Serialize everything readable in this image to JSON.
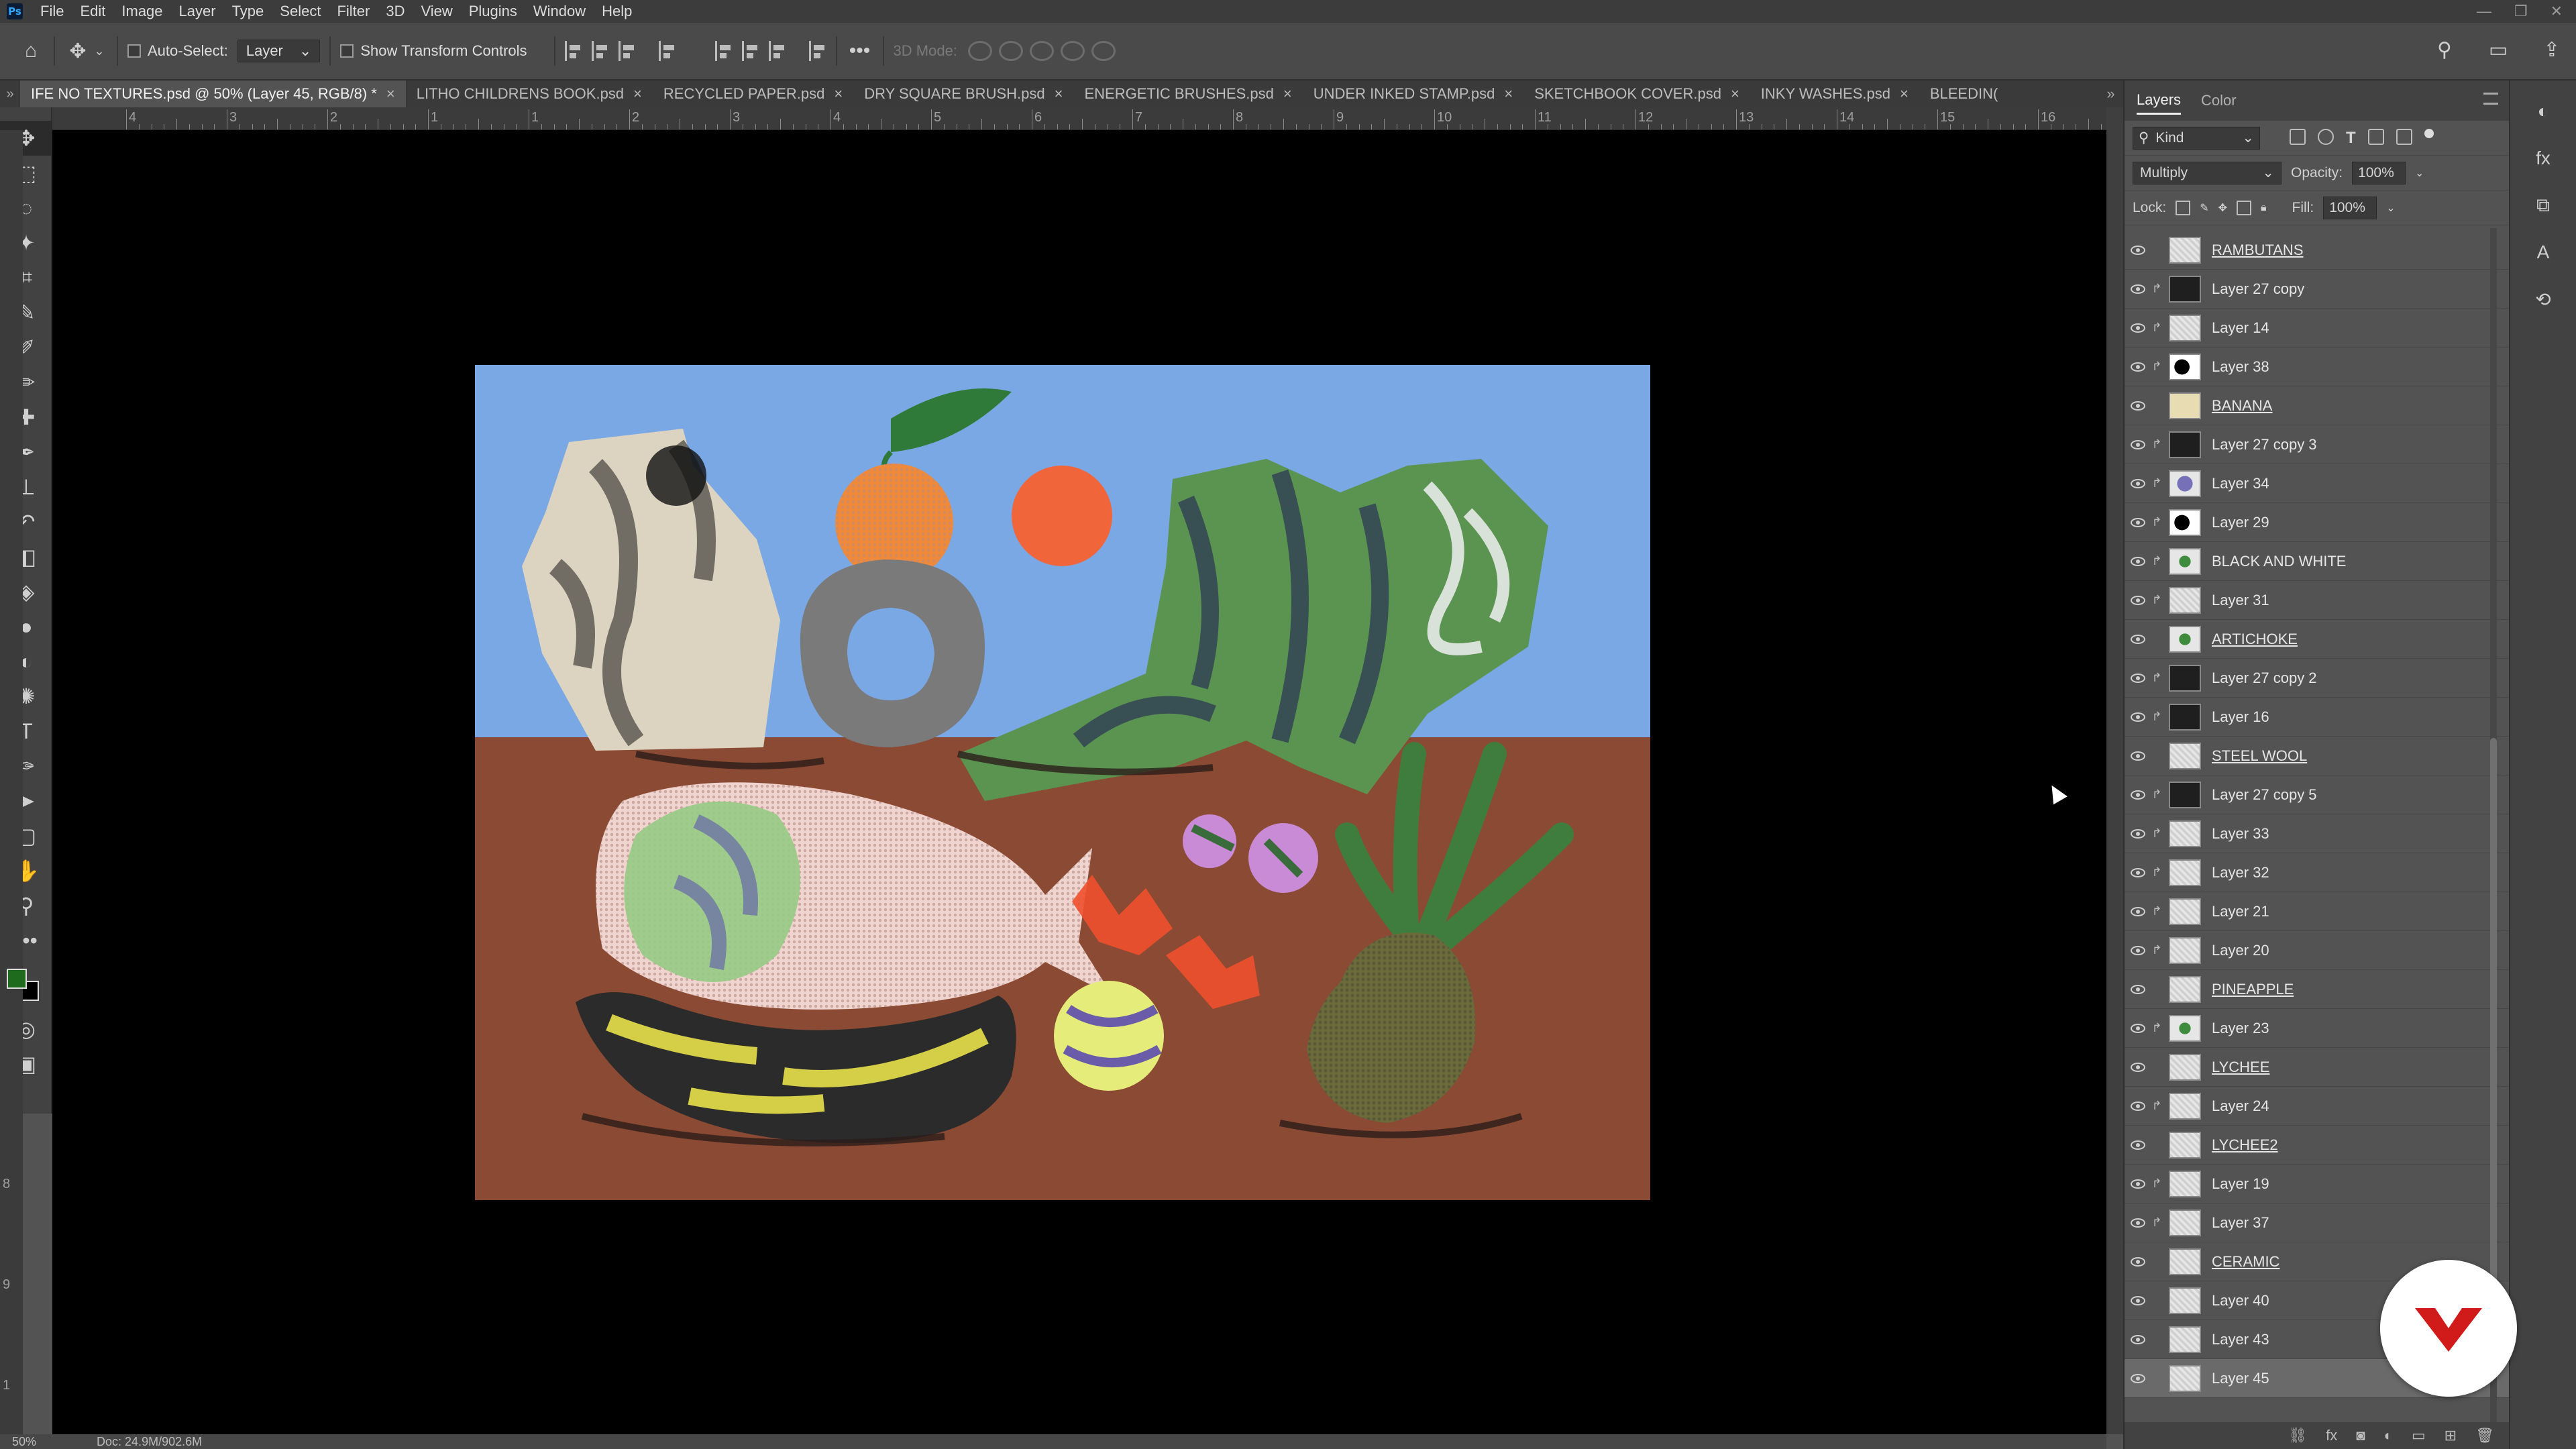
{
  "menu": [
    "File",
    "Edit",
    "Image",
    "Layer",
    "Type",
    "Select",
    "Filter",
    "3D",
    "View",
    "Plugins",
    "Window",
    "Help"
  ],
  "options": {
    "auto_select_label": "Auto-Select:",
    "auto_select_value": "Layer",
    "show_transform_label": "Show Transform Controls",
    "mode_3d_label": "3D Mode:"
  },
  "tabs": [
    {
      "label": "IFE NO TEXTURES.psd @ 50% (Layer 45, RGB/8) *",
      "active": true
    },
    {
      "label": "LITHO CHILDRENS BOOK.psd"
    },
    {
      "label": "RECYCLED PAPER.psd"
    },
    {
      "label": "DRY SQUARE BRUSH.psd"
    },
    {
      "label": "ENERGETIC BRUSHES.psd"
    },
    {
      "label": "UNDER INKED STAMP.psd"
    },
    {
      "label": "SKETCHBOOK COVER.psd"
    },
    {
      "label": "INKY WASHES.psd"
    },
    {
      "label": "BLEEDIN("
    }
  ],
  "ruler_h": [
    "4",
    "3",
    "2",
    "1",
    "1",
    "2",
    "3",
    "4",
    "5",
    "6",
    "7",
    "8",
    "9",
    "10",
    "11",
    "12",
    "13",
    "14",
    "15",
    "16"
  ],
  "ruler_v": [
    "8",
    "9",
    "1"
  ],
  "panel": {
    "tab_layers": "Layers",
    "tab_color": "Color",
    "filter_kind": "Kind",
    "blend_mode": "Multiply",
    "opacity_label": "Opacity:",
    "opacity_value": "100%",
    "lock_label": "Lock:",
    "fill_label": "Fill:",
    "fill_value": "100%"
  },
  "layers": [
    {
      "name": "RAMBUTANS",
      "group": true,
      "thumb": "pat"
    },
    {
      "name": "Layer 27 copy",
      "clip": true,
      "thumb": "dark"
    },
    {
      "name": "Layer 14",
      "clip": true,
      "thumb": "pat"
    },
    {
      "name": "Layer 38",
      "clip": true,
      "thumb": "black"
    },
    {
      "name": "BANANA",
      "group": true,
      "thumb": "yellow"
    },
    {
      "name": "Layer 27 copy 3",
      "clip": true,
      "thumb": "dark"
    },
    {
      "name": "Layer 34",
      "clip": true,
      "thumb": "purple"
    },
    {
      "name": "Layer 29",
      "clip": true,
      "thumb": "black"
    },
    {
      "name": "BLACK AND WHITE",
      "clip": true,
      "thumb": "green"
    },
    {
      "name": "Layer 31",
      "clip": true,
      "thumb": "pat"
    },
    {
      "name": "ARTICHOKE",
      "group": true,
      "thumb": "green"
    },
    {
      "name": "Layer 27 copy 2",
      "clip": true,
      "thumb": "dark"
    },
    {
      "name": "Layer 16",
      "clip": true,
      "thumb": "dark"
    },
    {
      "name": "STEEL WOOL",
      "group": true,
      "thumb": "pat"
    },
    {
      "name": "Layer 27 copy 5",
      "clip": true,
      "thumb": "dark"
    },
    {
      "name": "Layer 33",
      "clip": true,
      "thumb": "pat"
    },
    {
      "name": "Layer 32",
      "clip": true,
      "thumb": "pat"
    },
    {
      "name": "Layer 21",
      "clip": true,
      "thumb": "pat"
    },
    {
      "name": "Layer 20",
      "clip": true,
      "thumb": "pat"
    },
    {
      "name": "PINEAPPLE",
      "group": true,
      "thumb": "pat"
    },
    {
      "name": "Layer 23",
      "clip": true,
      "thumb": "green"
    },
    {
      "name": "LYCHEE",
      "group": true,
      "thumb": "pat"
    },
    {
      "name": "Layer 24",
      "clip": true,
      "thumb": "pat"
    },
    {
      "name": "LYCHEE2",
      "group": true,
      "thumb": "pat"
    },
    {
      "name": "Layer 19",
      "clip": true,
      "thumb": "pat"
    },
    {
      "name": "Layer 37",
      "clip": true,
      "thumb": "pat"
    },
    {
      "name": "CERAMIC",
      "group": true,
      "thumb": "pat"
    },
    {
      "name": "Layer 40",
      "thumb": "pat"
    },
    {
      "name": "Layer 43",
      "thumb": "pat"
    },
    {
      "name": "Layer 45",
      "thumb": "pat",
      "selected": true
    }
  ],
  "status": {
    "zoom": "50%",
    "doc": "Doc: 24.9M/902.6M"
  }
}
